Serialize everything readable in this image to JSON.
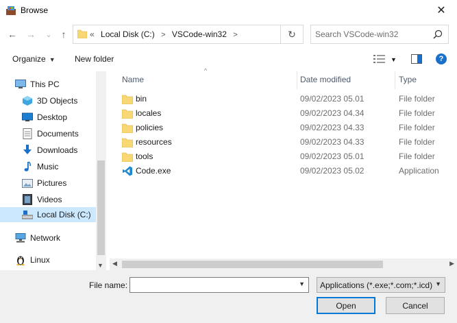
{
  "window": {
    "title": "Browse",
    "close_glyph": "✕"
  },
  "nav": {
    "back_glyph": "←",
    "forward_glyph": "→",
    "recent_glyph": "⌄",
    "up_glyph": "↑",
    "breadcrumb": [
      "Local Disk (C:)",
      "VSCode-win32"
    ],
    "overflow_glyph": "«",
    "refresh_glyph": "↻"
  },
  "search": {
    "placeholder": "Search VSCode-win32"
  },
  "toolbar": {
    "organize_label": "Organize",
    "new_folder_label": "New folder",
    "help_glyph": "?"
  },
  "sidebar": {
    "items": [
      {
        "label": "This PC",
        "icon": "computer-icon"
      },
      {
        "label": "3D Objects",
        "icon": "3d-objects-icon"
      },
      {
        "label": "Desktop",
        "icon": "desktop-icon"
      },
      {
        "label": "Documents",
        "icon": "documents-icon"
      },
      {
        "label": "Downloads",
        "icon": "downloads-icon"
      },
      {
        "label": "Music",
        "icon": "music-icon"
      },
      {
        "label": "Pictures",
        "icon": "pictures-icon"
      },
      {
        "label": "Videos",
        "icon": "videos-icon"
      },
      {
        "label": "Local Disk (C:)",
        "icon": "drive-icon",
        "selected": true
      },
      {
        "label": "Network",
        "icon": "network-icon"
      },
      {
        "label": "Linux",
        "icon": "linux-icon"
      }
    ]
  },
  "columns": {
    "name": "Name",
    "date": "Date modified",
    "type": "Type"
  },
  "files": [
    {
      "name": "bin",
      "date": "09/02/2023 05.01",
      "type": "File folder",
      "icon": "folder-icon"
    },
    {
      "name": "locales",
      "date": "09/02/2023 04.34",
      "type": "File folder",
      "icon": "folder-icon"
    },
    {
      "name": "policies",
      "date": "09/02/2023 04.33",
      "type": "File folder",
      "icon": "folder-icon"
    },
    {
      "name": "resources",
      "date": "09/02/2023 04.33",
      "type": "File folder",
      "icon": "folder-icon"
    },
    {
      "name": "tools",
      "date": "09/02/2023 05.01",
      "type": "File folder",
      "icon": "folder-icon"
    },
    {
      "name": "Code.exe",
      "date": "09/02/2023 05.02",
      "type": "Application",
      "icon": "vscode-icon"
    }
  ],
  "bottom": {
    "file_name_label": "File name:",
    "file_name_value": "",
    "filter_value": "Applications (*.exe;*.com;*.icd)",
    "open_label": "Open",
    "cancel_label": "Cancel"
  },
  "colors": {
    "selected_bg": "#cce8ff",
    "folder_yellow": "#f8d775",
    "accent_blue": "#0078d7"
  }
}
